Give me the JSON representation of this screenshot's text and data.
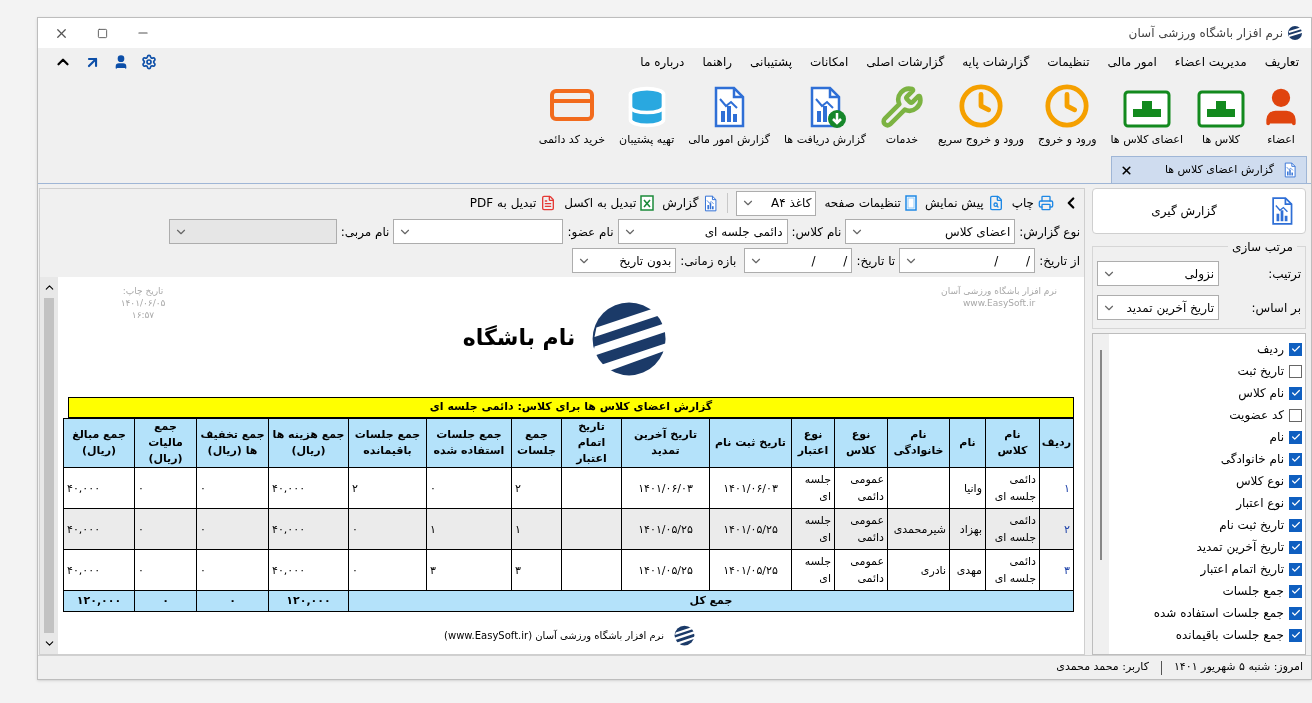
{
  "window": {
    "title": "نرم افزار باشگاه ورزشی آسان"
  },
  "menu": [
    "تعاریف",
    "مدیریت اعضاء",
    "امور مالی",
    "تنظیمات",
    "گزارشات پایه",
    "گزارشات اصلی",
    "امکانات",
    "پشتیبانی",
    "راهنما",
    "درباره ما"
  ],
  "toolbar": [
    {
      "label": "اعضاء",
      "kind": "person"
    },
    {
      "label": "کلاس ها",
      "kind": "box"
    },
    {
      "label": "اعضای کلاس ها",
      "kind": "box"
    },
    {
      "label": "ورود و خروج",
      "kind": "clock"
    },
    {
      "label": "ورود و خروج سریع",
      "kind": "clock"
    },
    {
      "label": "خدمات",
      "kind": "tools"
    },
    {
      "label": "گزارش دریافت ها",
      "kind": "report-download"
    },
    {
      "label": "گزارش امور مالی",
      "kind": "report"
    },
    {
      "label": "تهیه پشتیبان",
      "kind": "database"
    },
    {
      "label": "خرید کد دائمی",
      "kind": "card"
    }
  ],
  "tabs": [
    {
      "label": "گزارش اعضای کلاس ها",
      "selected": true
    }
  ],
  "report_toolbar": {
    "buttons_1": [
      {
        "label": "چاپ",
        "kind": "print"
      },
      {
        "label": "پیش نمایش",
        "kind": "preview"
      },
      {
        "label": "تنظیمات صفحه",
        "kind": "page"
      }
    ],
    "paper_size": "کاغذ A۴",
    "buttons_2": [
      {
        "label": "گزارش",
        "kind": "report"
      },
      {
        "label": "تبدیل به اکسل",
        "kind": "excel"
      },
      {
        "label": "تبدیل به PDF",
        "kind": "pdf"
      }
    ]
  },
  "filters": [
    {
      "label": "نوع گزارش:",
      "value": "اعضای کلاس",
      "disabled": false
    },
    {
      "label": "نام کلاس:",
      "value": "دائمی جلسه ای",
      "disabled": false
    },
    {
      "label": "نام عضو:",
      "disabled": false
    },
    {
      "label": "نام مربی:",
      "disabled": true
    }
  ],
  "dates": {
    "from_label": "از تاریخ:",
    "from_value": "/ /",
    "to_label": "تا تاریخ:",
    "to_value": "/ /",
    "period_label": "بازه زمانی:",
    "period_value": "بدون تاریخ"
  },
  "report": {
    "print_info": [
      "تاریخ چاپ:",
      "۱۴۰۱/۰۶/۰۵",
      "۱۶:۵۷"
    ],
    "software_info": [
      "نرم افزار باشگاه ورزشی آسان",
      "www.EasySoft.ir"
    ],
    "club_name": "نام باشگاه",
    "title": "گزارش اعضای کلاس ها برای کلاس: دائمی جلسه ای",
    "columns": [
      "ردیف",
      "نام کلاس",
      "نام",
      "نام خانوادگی",
      "نوع کلاس",
      "نوع اعتبار",
      "تاریخ ثبت نام",
      "تاریخ آخرین تمدید",
      "تاریخ اتمام اعتبار",
      "جمع جلسات",
      "جمع جلسات استفاده شده",
      "جمع جلسات باقیمانده",
      "جمع هزینه ها (ریال)",
      "جمع تخفیف ها (ریال)",
      "جمع مالیات (ریال)",
      "جمع مبالغ (ریال)"
    ],
    "rows": [
      [
        "۱",
        "دائمی جلسه ای",
        "وانیا",
        null,
        "عمومی دائمی",
        "جلسه ای",
        "۱۴۰۱/۰۶/۰۳",
        "۱۴۰۱/۰۶/۰۳",
        null,
        "۲",
        "۰",
        "۲",
        "۴۰,۰۰۰",
        "۰",
        "۰",
        "۴۰,۰۰۰"
      ],
      [
        "۲",
        "دائمی جلسه ای",
        "بهزاد",
        "شیرمحمدی",
        "عمومی دائمی",
        "جلسه ای",
        "۱۴۰۱/۰۵/۲۵",
        "۱۴۰۱/۰۵/۲۵",
        null,
        "۱",
        "۱",
        "۰",
        "۴۰,۰۰۰",
        "۰",
        "۰",
        "۴۰,۰۰۰"
      ],
      [
        "۳",
        "دائمی جلسه ای",
        "مهدی",
        "نادری",
        "عمومی دائمی",
        "جلسه ای",
        "۱۴۰۱/۰۵/۲۵",
        "۱۴۰۱/۰۵/۲۵",
        null,
        "۳",
        "۳",
        "۰",
        "۴۰,۰۰۰",
        "۰",
        "۰",
        "۴۰,۰۰۰"
      ]
    ],
    "totals": {
      "label": "جمع کل",
      "values": [
        "۱۲۰,۰۰۰",
        "۰",
        "۰",
        "۱۲۰,۰۰۰"
      ]
    },
    "footer": "نرم افزار باشگاه ورزشی آسان (www.EasySoft.ir)"
  },
  "sidebar": {
    "generate_button": "گزارش گیری",
    "sort": {
      "title": "مرتب سازی",
      "order_label": "ترتیب:",
      "order_value": "نزولی",
      "by_label": "بر اساس:",
      "by_value": "تاریخ آخرین تمدید"
    },
    "fields": [
      {
        "label": "ردیف",
        "checked": true
      },
      {
        "label": "تاریخ ثبت",
        "checked": false
      },
      {
        "label": "نام کلاس",
        "checked": true
      },
      {
        "label": "کد عضویت",
        "checked": false
      },
      {
        "label": "نام",
        "checked": true
      },
      {
        "label": "نام خانوادگی",
        "checked": true
      },
      {
        "label": "نوع کلاس",
        "checked": true
      },
      {
        "label": "نوع اعتبار",
        "checked": true
      },
      {
        "label": "تاریخ ثبت نام",
        "checked": true
      },
      {
        "label": "تاریخ آخرین تمدید",
        "checked": true
      },
      {
        "label": "تاریخ اتمام اعتبار",
        "checked": true
      },
      {
        "label": "جمع جلسات",
        "checked": true
      },
      {
        "label": "جمع جلسات استفاده شده",
        "checked": true
      },
      {
        "label": "جمع جلسات باقیمانده",
        "checked": true
      }
    ]
  },
  "status_bar": [
    "امروز: شنبه ۵ شهریور ۱۴۰۱",
    "کاربر: محمد محمدی"
  ]
}
